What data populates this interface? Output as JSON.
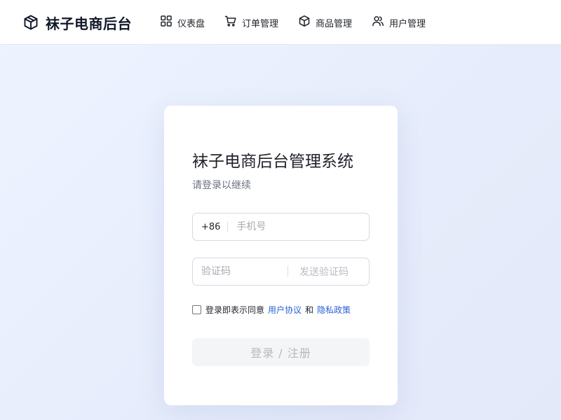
{
  "header": {
    "brand_icon": "cube-icon",
    "brand_name": "袜子电商后台",
    "nav": [
      {
        "icon": "dashboard-grid-icon",
        "label": "仪表盘"
      },
      {
        "icon": "shopping-cart-icon",
        "label": "订单管理"
      },
      {
        "icon": "box-icon",
        "label": "商品管理"
      },
      {
        "icon": "users-icon",
        "label": "用户管理"
      }
    ]
  },
  "login": {
    "title": "袜子电商后台管理系统",
    "subtitle": "请登录以继续",
    "phone_prefix": "+86",
    "phone_placeholder": "手机号",
    "phone_value": "",
    "code_placeholder": "验证码",
    "code_value": "",
    "send_code_label": "发送验证码",
    "agree_checked": false,
    "agree_text": "登录即表示同意",
    "user_agreement": "用户协议",
    "and_text": "和",
    "privacy_policy": "隐私政策",
    "submit_label": "登录 / 注册"
  },
  "colors": {
    "link": "#2860d8",
    "background": "#e8eefc",
    "card": "#ffffff",
    "button_disabled_bg": "#f4f5f7",
    "button_disabled_text": "#b5b8be"
  }
}
